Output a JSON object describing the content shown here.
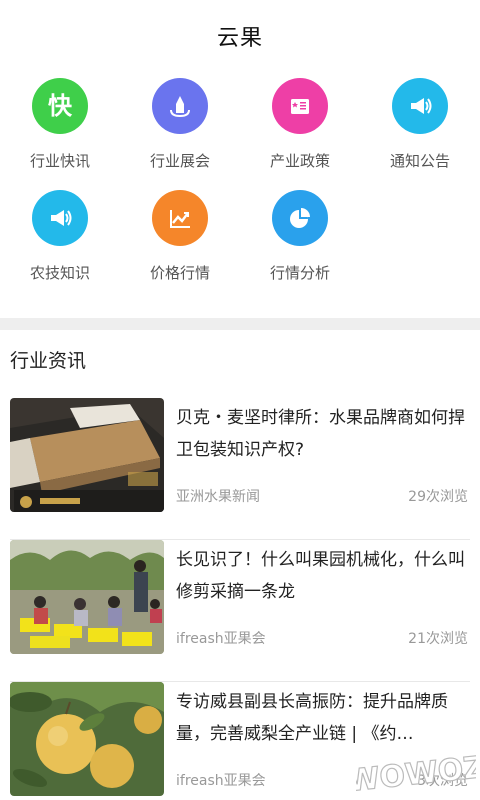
{
  "header": {
    "title": "云果"
  },
  "categories": [
    {
      "label": "行业快讯",
      "icon": "kuai-badge-icon",
      "color": "#3fcf4a",
      "glyph": "快"
    },
    {
      "label": "行业展会",
      "icon": "exhibition-icon",
      "color": "#6a74ee"
    },
    {
      "label": "产业政策",
      "icon": "policy-doc-icon",
      "color": "#ee3fa6"
    },
    {
      "label": "通知公告",
      "icon": "megaphone-icon",
      "color": "#23b9ea"
    },
    {
      "label": "农技知识",
      "icon": "megaphone-icon",
      "color": "#23b9ea"
    },
    {
      "label": "价格行情",
      "icon": "trend-chart-icon",
      "color": "#f5862a"
    },
    {
      "label": "行情分析",
      "icon": "pie-chart-icon",
      "color": "#2aa1ec"
    }
  ],
  "section": {
    "title": "行业资讯"
  },
  "news": [
    {
      "title": "贝克・麦坚时律所：水果品牌商如何捍卫包装知识产权?",
      "source": "亚洲水果新闻",
      "views": "29次浏览",
      "thumb": "fruit-box-image"
    },
    {
      "title": "长见识了！什么叫果园机械化，什么叫修剪采摘一条龙",
      "source": "ifreash亚果会",
      "views": "21次浏览",
      "thumb": "orchard-workers-image"
    },
    {
      "title": "专访威县副县长高振防：提升品牌质量，完善威梨全产业链 | 《约…",
      "source": "ifreash亚果会",
      "views": "3次浏览",
      "thumb": "pears-image"
    }
  ],
  "watermark": {
    "text": "WOWOZ"
  }
}
